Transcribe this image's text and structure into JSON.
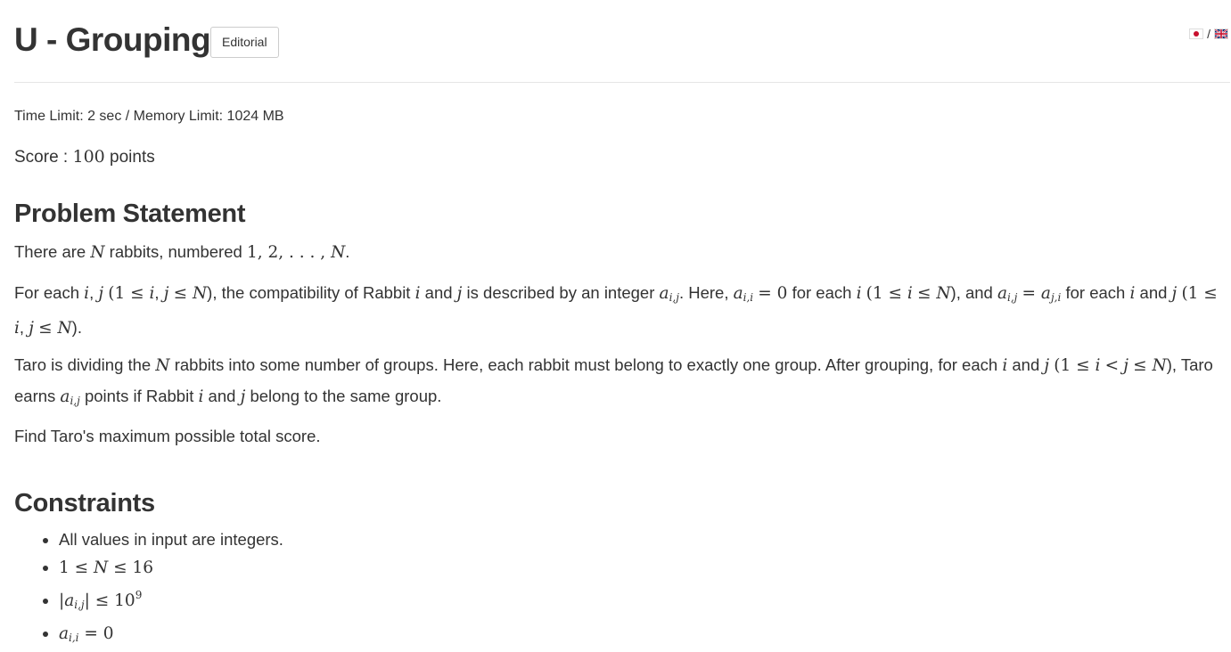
{
  "header": {
    "title": "U - Grouping",
    "editorial_label": "Editorial",
    "lang_separator": "/",
    "flags": [
      "japan-flag-icon",
      "uk-flag-icon"
    ]
  },
  "limits": "Time Limit: 2 sec / Memory Limit: 1024 MB",
  "score": {
    "prefix": "Score : ",
    "value": "100",
    "suffix": " points"
  },
  "problem": {
    "heading": "Problem Statement",
    "p1": {
      "a": "There are ",
      "N": "N",
      "b": " rabbits, numbered ",
      "seq": "1, 2, . . . , ",
      "N2": "N",
      "c": "."
    },
    "p2_line1": "For each i, j (1 ≤ i, j ≤ N), the compatibility of Rabbit i and j is described by an integer a",
    "p3": "Taro is dividing the N rabbits into some number of groups. Here, each rabbit must belong to exactly one group. After grouping, for each i and j (1 ≤ i <",
    "p4": "Find Taro's maximum possible total score."
  },
  "constraints": {
    "heading": "Constraints",
    "items": [
      "All values in input are integers.",
      "1 ≤ N ≤ 16",
      "|a_{i,j}| ≤ 10^9",
      "a_{i,i} = 0"
    ]
  }
}
